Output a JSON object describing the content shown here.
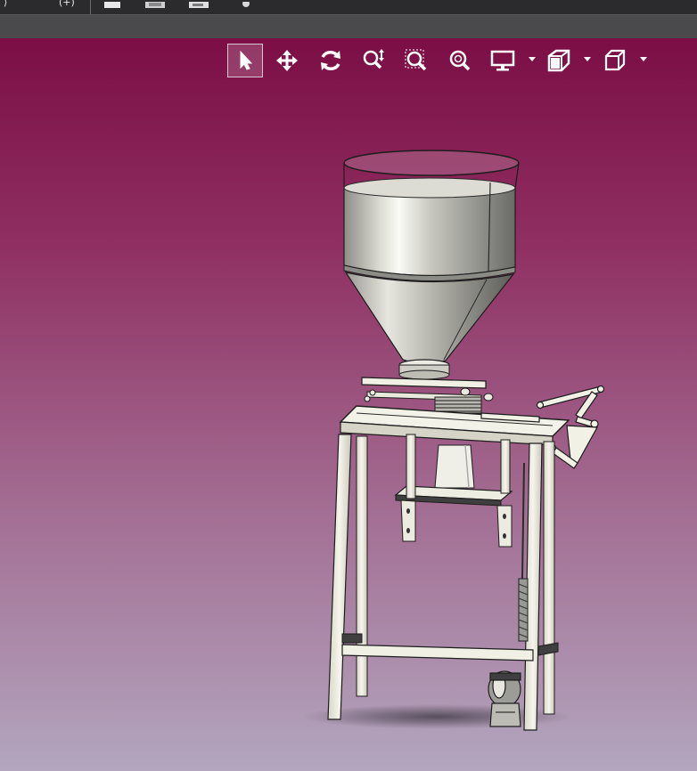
{
  "app": {
    "top_bar": {
      "items": [
        {
          "name": "back-arrow-icon",
          "text": "⟩"
        },
        {
          "name": "bracket-icon",
          "text": "(+)"
        },
        {
          "name": "save-icon",
          "text": ""
        },
        {
          "name": "print-icon",
          "text": ""
        },
        {
          "name": "options-icon",
          "text": ""
        },
        {
          "name": "settings-icon",
          "text": ""
        }
      ]
    }
  },
  "heads_up_toolbar": {
    "tools": [
      {
        "name": "select-tool",
        "icon": "cursor-arrow-icon",
        "active": true
      },
      {
        "name": "pan-tool",
        "icon": "move-arrows-icon",
        "active": false
      },
      {
        "name": "rotate-tool",
        "icon": "rotate-icon",
        "active": false
      },
      {
        "name": "zoom-in-out-tool",
        "icon": "zoom-in-out-icon",
        "active": false
      },
      {
        "name": "zoom-to-area-tool",
        "icon": "zoom-area-icon",
        "active": false
      },
      {
        "name": "zoom-to-fit-tool",
        "icon": "zoom-fit-icon",
        "active": false
      },
      {
        "name": "display-style-tool",
        "icon": "monitor-icon",
        "active": false,
        "dropdown": true
      },
      {
        "name": "section-view-tool",
        "icon": "section-view-icon",
        "active": false,
        "dropdown": true
      },
      {
        "name": "view-orientation-tool",
        "icon": "cube-icon",
        "active": false,
        "dropdown": true
      }
    ]
  },
  "model": {
    "description_name": "filling-machine-model",
    "colors": {
      "background_top": "#7b0e45",
      "background_bottom": "#b3a6be",
      "frame": "#f2f1e6",
      "frame_shade": "#b9b8a8",
      "hopper_light": "#efefe8",
      "hopper_dark": "#6e6e6a",
      "outline": "#1f1f1f"
    }
  }
}
